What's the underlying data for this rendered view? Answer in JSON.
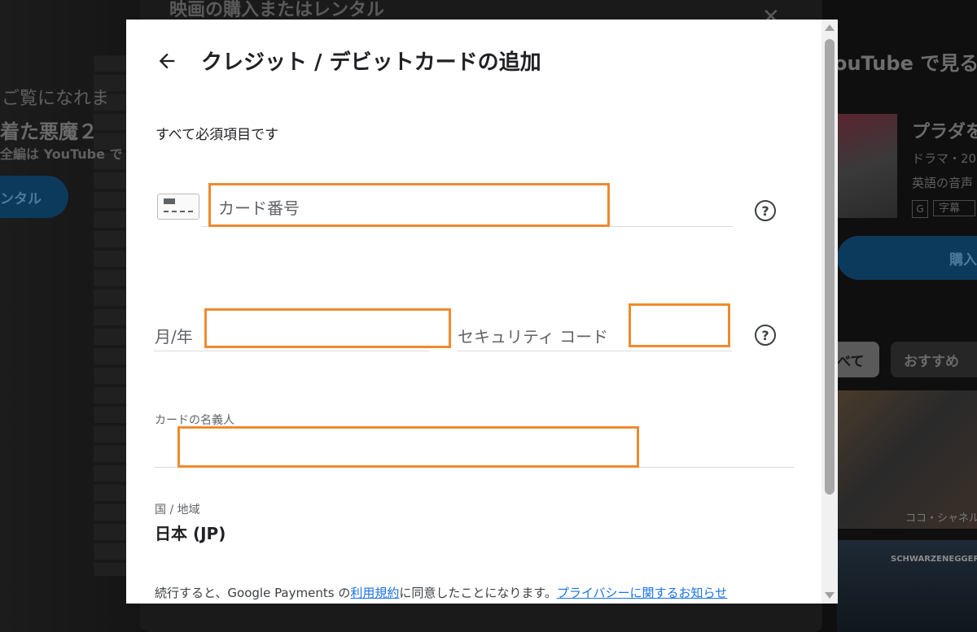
{
  "background": {
    "back_dialog_title": "映画の購入またはレンタル",
    "left_line1": "ご覧になれま",
    "left_line2": "着た悪魔２",
    "left_line3": "全編は YouTube で",
    "rent_button": "ンタル",
    "right_title": "ouTube で見る",
    "movie_title": "プラダを",
    "movie_meta1": "ドラマ・20",
    "movie_meta2": "英語の音声",
    "rating_chip": "G",
    "subtitle_chip": "字幕",
    "buy_button": "購入",
    "chip_all": "べて",
    "chip_recommended": "おすすめ",
    "thumb1_caption": "ココ・シャネル",
    "thumb2_caption": "SCHWARZENEGGER"
  },
  "modal": {
    "title": "クレジット / デビットカードの追加",
    "required_note": "すべて必須項目です",
    "card_number": {
      "placeholder": "カード番号",
      "value": ""
    },
    "expiry": {
      "label": "月/年",
      "value": ""
    },
    "security_code": {
      "label": "セキュリティ コード",
      "value": ""
    },
    "cardholder": {
      "label": "カードの名義人",
      "value": ""
    },
    "country": {
      "label": "国 / 地域",
      "value": "日本 (JP)"
    },
    "terms": {
      "prefix": "続行すると、Google Payments の",
      "tos_link": "利用規約",
      "middle": "に同意したことになります。",
      "privacy_link": "プライバシーに関するお知らせ"
    }
  },
  "colors": {
    "highlight_box": "#f08a2e",
    "link": "#1a73e8",
    "overlay": "#0f0f0f"
  },
  "icons": [
    "back-arrow-icon",
    "credit-card-icon",
    "help-icon",
    "close-icon"
  ]
}
